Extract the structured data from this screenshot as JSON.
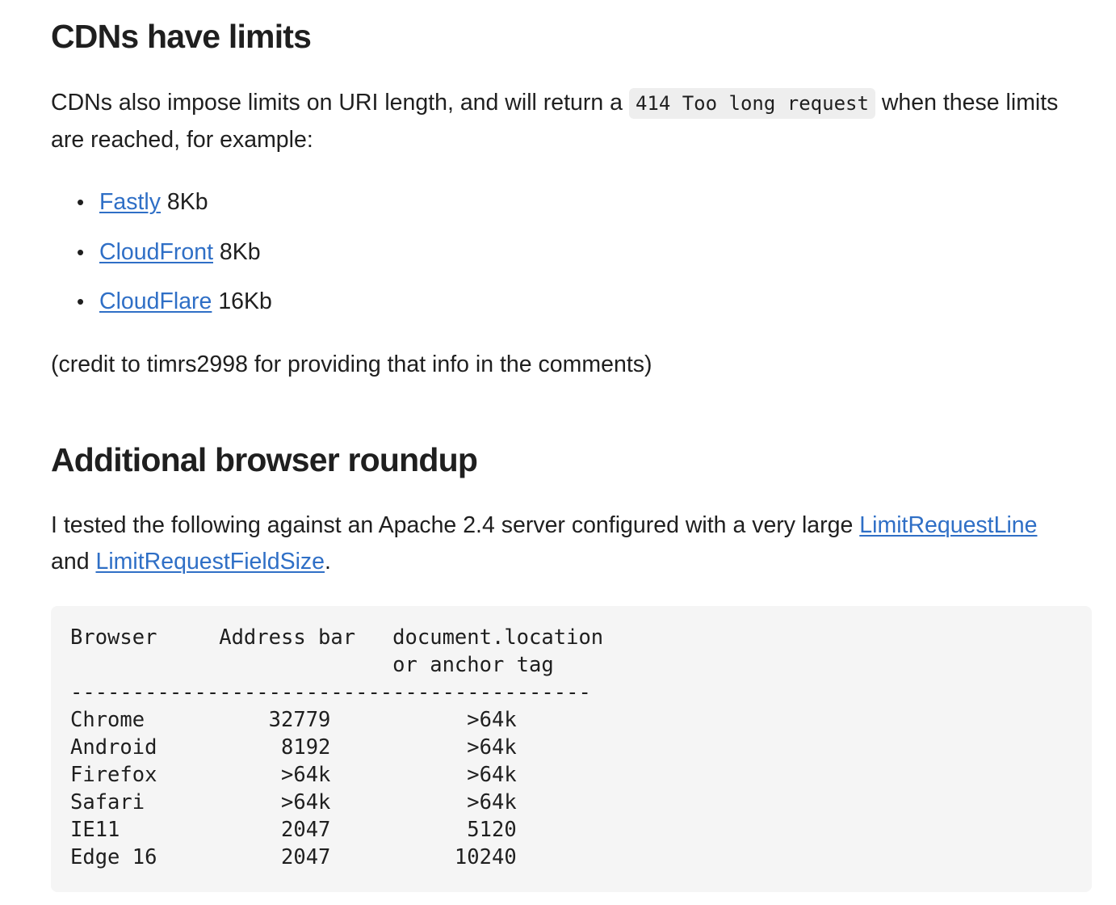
{
  "section1": {
    "heading": "CDNs have limits",
    "intro_before": "CDNs also impose limits on URI length, and will return a ",
    "intro_code": "414 Too long request",
    "intro_after": " when these limits are reached, for example:",
    "items": [
      {
        "link": "Fastly",
        "size": " 8Kb"
      },
      {
        "link": "CloudFront",
        "size": " 8Kb"
      },
      {
        "link": "CloudFlare",
        "size": " 16Kb"
      }
    ],
    "credit": "(credit to timrs2998 for providing that info in the comments)"
  },
  "section2": {
    "heading": "Additional browser roundup",
    "text_before": "I tested the following against an Apache 2.4 server configured with a very large ",
    "link1": "LimitRequestLine",
    "text_middle": " and ",
    "link2": "LimitRequestFieldSize",
    "text_after": ".",
    "code_block": "Browser     Address bar   document.location\n                          or anchor tag\n------------------------------------------\nChrome          32779           >64k\nAndroid          8192           >64k\nFirefox          >64k           >64k\nSafari           >64k           >64k\nIE11             2047           5120\nEdge 16          2047          10240"
  },
  "colors": {
    "link": "#2f6fc6",
    "code_background": "#f5f5f5",
    "inline_code_background": "#eeeeee",
    "text": "#1f1f1f"
  }
}
